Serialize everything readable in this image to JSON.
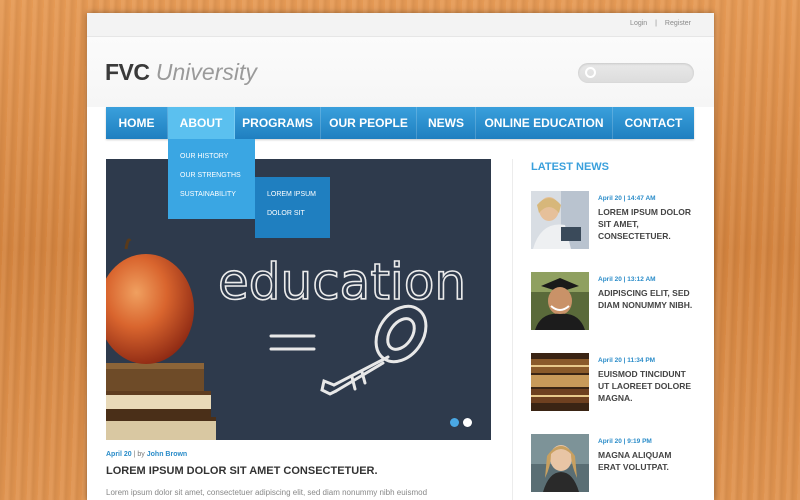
{
  "topbar": {
    "login": "Login",
    "separator": "|",
    "register": "Register"
  },
  "logo": {
    "bold": "FVC",
    "light": "University"
  },
  "search": {
    "placeholder": "",
    "value": ""
  },
  "nav": {
    "items": [
      "HOME",
      "ABOUT",
      "PROGRAMS",
      "OUR PEOPLE",
      "NEWS",
      "ONLINE EDUCATION",
      "CONTACT"
    ],
    "active": "ABOUT"
  },
  "about_menu": {
    "items": [
      "OUR HISTORY",
      "OUR STRENGTHS",
      "SUSTAINABILITY"
    ]
  },
  "sustainability_submenu": {
    "items": [
      "LOREM IPSUM",
      "DOLOR SIT"
    ]
  },
  "hero": {
    "chalk_word": "education",
    "slides": 2,
    "current_slide": 1
  },
  "featured": {
    "date": "April 20",
    "by": "| by",
    "author": "John Brown",
    "title": "LOREM IPSUM DOLOR SIT AMET CONSECTETUER.",
    "excerpt": "Lorem ipsum dolor sit amet, consectetuer adipiscing elit, sed diam nonummy nibh euismod"
  },
  "latest_news": {
    "title": "LATEST NEWS",
    "items": [
      {
        "date": "April 20 | 14:47 AM",
        "title": "LOREM IPSUM DOLOR SIT AMET, CONSECTETUER."
      },
      {
        "date": "April 20 | 13:12 AM",
        "title": "ADIPISCING ELIT, SED DIAM NONUMMY NIBH."
      },
      {
        "date": "April 20 | 11:34 PM",
        "title": "EUISMOD TINCIDUNT UT LAOREET DOLORE MAGNA."
      },
      {
        "date": "April 20 | 9:19 PM",
        "title": "MAGNA ALIQUAM ERAT VOLUTPAT."
      }
    ]
  },
  "colors": {
    "accent": "#2a8cc9",
    "nav": "#1f7fc0",
    "nav_active": "#5bc0ef",
    "background_wood": "#d98a45"
  }
}
